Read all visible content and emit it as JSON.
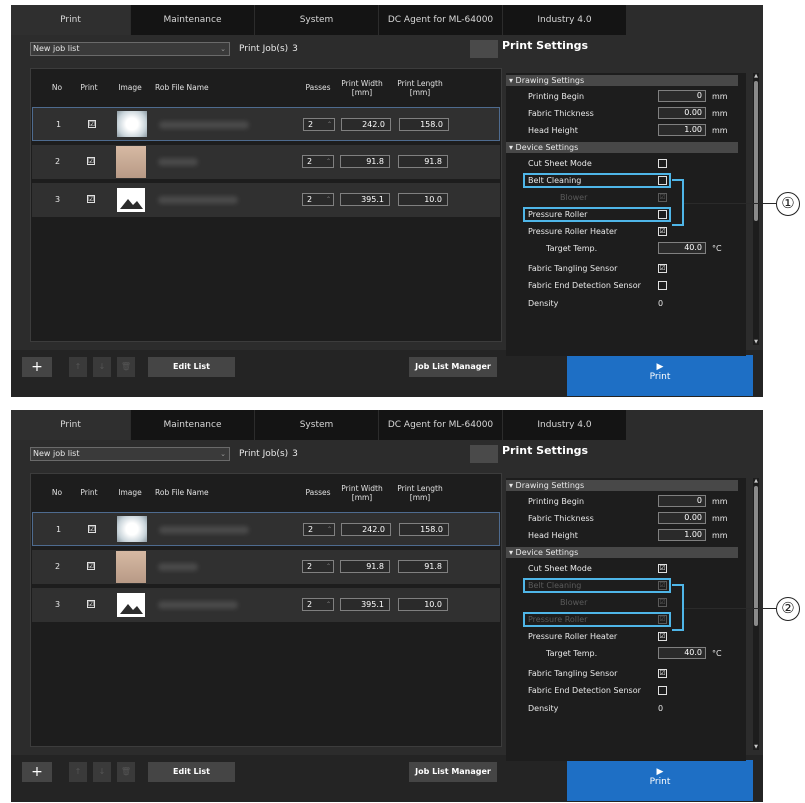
{
  "tabs": [
    "Print",
    "Maintenance",
    "System",
    "DC Agent for ML-64000",
    "Industry 4.0"
  ],
  "job_list": {
    "dropdown_value": "New job list",
    "print_jobs_label": "Print Job(s)",
    "print_jobs_count": "3",
    "expand_label": "»",
    "headers": {
      "no": "No",
      "print": "Print",
      "image": "Image",
      "file": "Rob File Name",
      "passes": "Passes",
      "width": "Print Width [mm]",
      "length": "Print Length [mm]"
    },
    "rows": [
      {
        "no": "1",
        "print": "☑",
        "passes": "2",
        "width": "242.0",
        "length": "158.0"
      },
      {
        "no": "2",
        "print": "☑",
        "passes": "2",
        "width": "91.8",
        "length": "91.8"
      },
      {
        "no": "3",
        "print": "☑",
        "passes": "2",
        "width": "395.1",
        "length": "10.0"
      }
    ]
  },
  "toolbar": {
    "add_label": "+",
    "up_label": "↑",
    "down_label": "↓",
    "delete_label": "🗑",
    "edit_list_label": "Edit List",
    "job_list_manager_label": "Job List Manager",
    "print_label": "Print",
    "print_icon": "▶"
  },
  "settings": {
    "title": "Print Settings",
    "drawing_section": "▾ Drawing Settings",
    "printing_begin_label": "Printing Begin",
    "printing_begin_value": "0",
    "fabric_thickness_label": "Fabric Thickness",
    "fabric_thickness_value": "0.00",
    "head_height_label": "Head Height",
    "head_height_value": "1.00",
    "unit_mm": "mm",
    "device_section": "▾ Device Settings",
    "cut_sheet_label": "Cut Sheet Mode",
    "belt_cleaning_label": "Belt Cleaning",
    "blower_label": "Blower",
    "pressure_roller_label": "Pressure Roller",
    "pressure_roller_heater_label": "Pressure Roller Heater",
    "target_temp_label": "Target Temp.",
    "target_temp_value": "40.0",
    "unit_c": "°C",
    "fabric_tangling_label": "Fabric Tangling Sensor",
    "fabric_end_label": "Fabric End Detection Sensor",
    "density_label": "Density",
    "density_value": "0",
    "checked": "☑",
    "unchecked": ""
  },
  "callouts": [
    "①",
    "②"
  ]
}
